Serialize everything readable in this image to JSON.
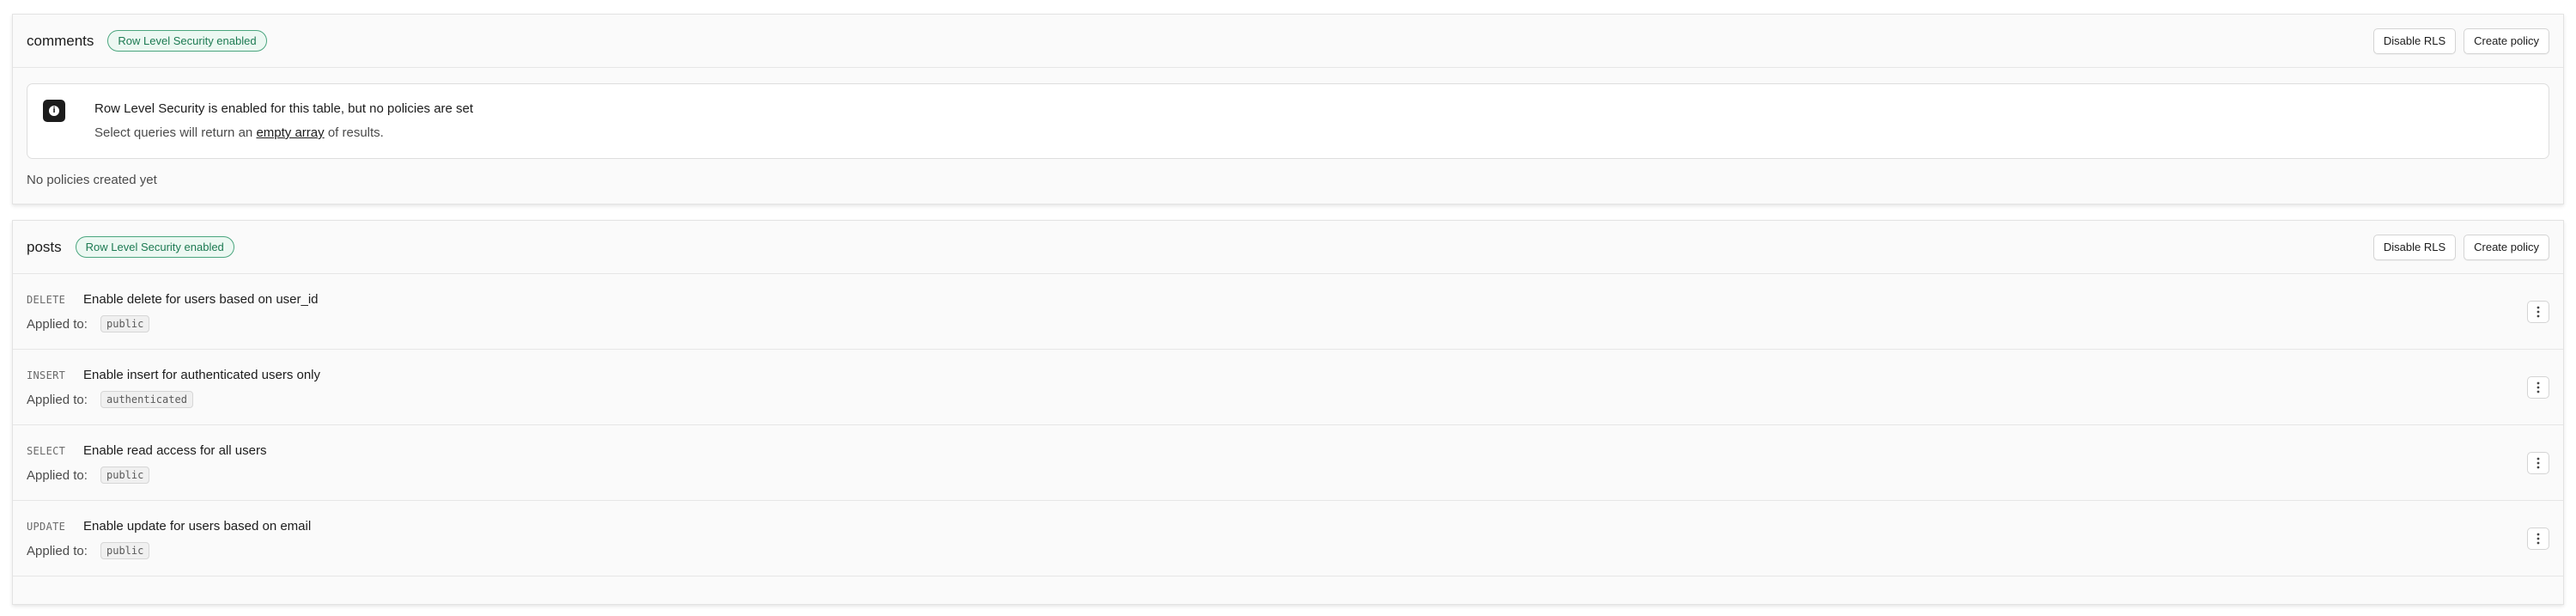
{
  "tables": [
    {
      "name": "comments",
      "badge": "Row Level Security enabled",
      "disable_label": "Disable RLS",
      "create_label": "Create policy",
      "alert": {
        "title": "Row Level Security is enabled for this table, but no policies are set",
        "desc_before": "Select queries will return an",
        "desc_link": "empty array",
        "desc_after": "of results."
      },
      "empty_note": "No policies created yet"
    },
    {
      "name": "posts",
      "badge": "Row Level Security enabled",
      "disable_label": "Disable RLS",
      "create_label": "Create policy",
      "policies": [
        {
          "command": "DELETE",
          "name": "Enable delete for users based on user_id",
          "applied_label": "Applied to:",
          "role": "public"
        },
        {
          "command": "INSERT",
          "name": "Enable insert for authenticated users only",
          "applied_label": "Applied to:",
          "role": "authenticated"
        },
        {
          "command": "SELECT",
          "name": "Enable read access for all users",
          "applied_label": "Applied to:",
          "role": "public"
        },
        {
          "command": "UPDATE",
          "name": "Enable update for users based on email",
          "applied_label": "Applied to:",
          "role": "public"
        }
      ]
    }
  ],
  "icons": {
    "alert": "info-icon",
    "row_menu": "more-vertical-icon"
  },
  "colors": {
    "badge_text": "#1c7a52",
    "badge_border": "#4aa57e",
    "badge_bg": "#ecf8f2",
    "alert_icon_bg": "#1c1c1c"
  }
}
